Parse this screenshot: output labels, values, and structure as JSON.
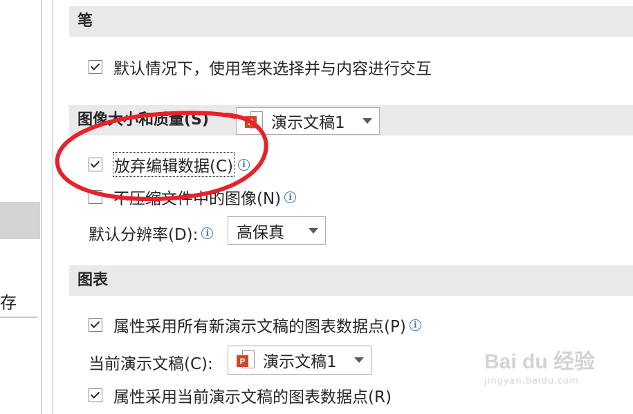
{
  "sidebar": {
    "partial_label": "存"
  },
  "pen_section": {
    "title": "笔",
    "option_label": "默认情况下，使用笔来选择并与内容进行交互",
    "option_checked": true
  },
  "image_section": {
    "title": "图像大小和质量(S)",
    "document_dropdown_value": "演示文稿1",
    "discard_edit_label": "放弃编辑数据(C)",
    "discard_edit_checked": true,
    "no_compress_label": "不压缩文件中的图像(N)",
    "no_compress_checked": false,
    "resolution_label": "默认分辨率(D):",
    "resolution_value": "高保真"
  },
  "chart_section": {
    "title": "图表",
    "all_docs_label": "属性采用所有新演示文稿的图表数据点(P)",
    "all_docs_checked": true,
    "current_doc_label": "当前演示文稿(C):",
    "current_doc_value": "演示文稿1",
    "current_doc_points_label": "属性采用当前演示文稿的图表数据点(R)",
    "current_doc_points_checked": true
  },
  "icons": {
    "info": "info-icon",
    "ppt": "powerpoint-file-icon",
    "dropdown": "chevron-down-icon"
  },
  "app_icon_letter": "P",
  "info_glyph": "i",
  "annotation": {
    "color": "#e8212a"
  },
  "watermark": {
    "line1": "Bai du 经验",
    "line2": "jingyan.baidu.com"
  }
}
